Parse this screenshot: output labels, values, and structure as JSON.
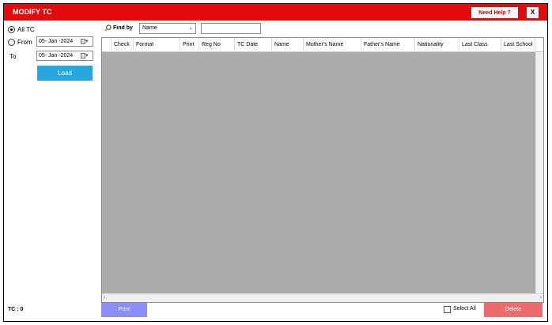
{
  "window": {
    "title": "MODIFY TC",
    "help_label": "Need Help ?",
    "close_label": "X"
  },
  "filters": {
    "all_tc_label": "All TC",
    "from_label": "From",
    "to_label": "To",
    "from_date": "05- Jan -2024",
    "to_date": "05- Jan -2024",
    "load_label": "Load",
    "selected": "All TC"
  },
  "search": {
    "findby_label": "Find by",
    "field_value": "Name",
    "query": ""
  },
  "grid": {
    "columns": [
      "Check",
      "Format",
      "Print",
      "Reg No",
      "TC Date",
      "Name",
      "Mother's Name",
      "Father's Name",
      "Nationality",
      "Last Class",
      "Last School"
    ],
    "rows": []
  },
  "footer": {
    "tc_count": "TC : 0",
    "print_label": "Print",
    "select_all_label": "Select All",
    "delete_label": "Delete"
  },
  "colors": {
    "titlebar": "#e30a0e",
    "load": "#26a8df",
    "print": "#8c8ef7",
    "delete": "#ef6b6b",
    "grid_bg": "#ababab"
  }
}
